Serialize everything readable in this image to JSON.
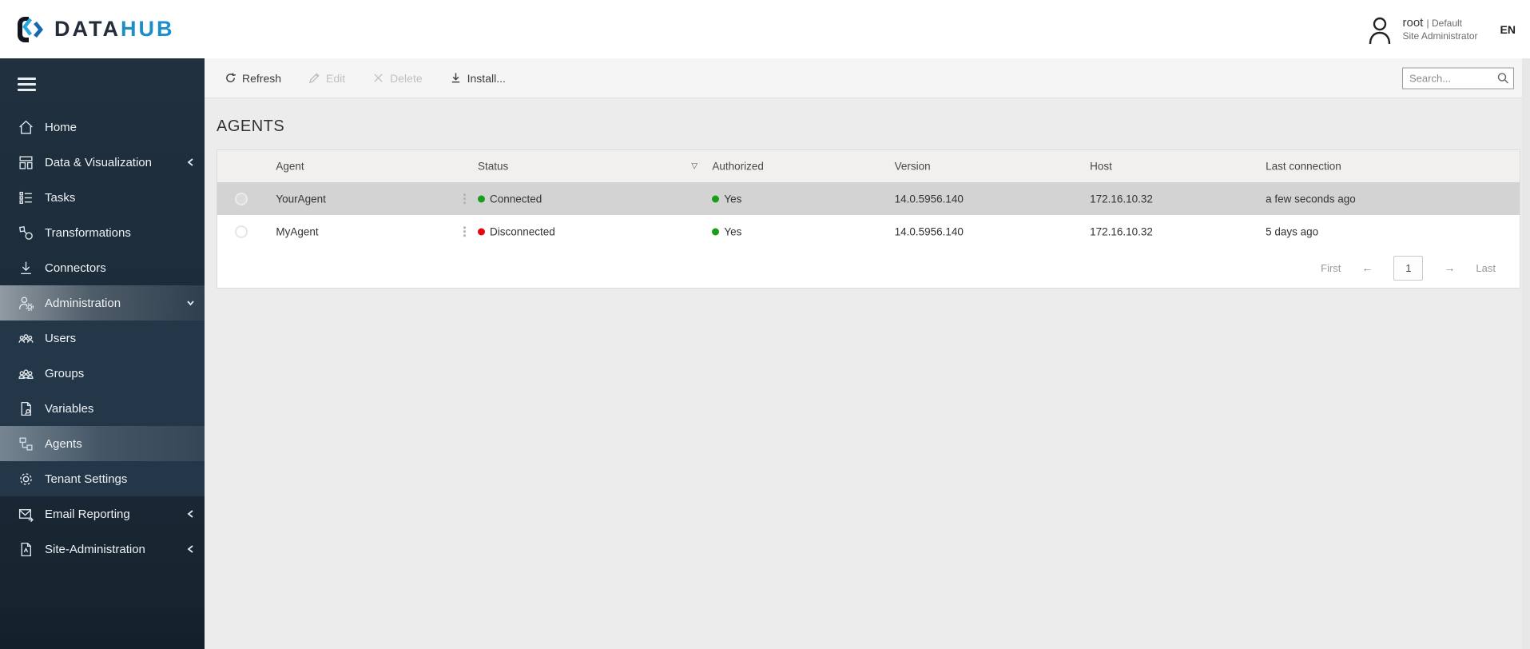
{
  "brand": {
    "word1": "DATA",
    "word2": "HUB"
  },
  "header": {
    "user_name": "root",
    "user_suffix": "| Default",
    "user_role": "Site Administrator",
    "language": "EN"
  },
  "sidebar": {
    "items": [
      {
        "label": "Home"
      },
      {
        "label": "Data & Visualization",
        "chevron": "left"
      },
      {
        "label": "Tasks"
      },
      {
        "label": "Transformations"
      },
      {
        "label": "Connectors"
      },
      {
        "label": "Administration",
        "chevron": "down",
        "selected": true,
        "expanded": true
      },
      {
        "label": "Users",
        "sub": true
      },
      {
        "label": "Groups",
        "sub": true
      },
      {
        "label": "Variables",
        "sub": true
      },
      {
        "label": "Agents",
        "sub": true,
        "selected": true
      },
      {
        "label": "Tenant Settings",
        "sub": true
      },
      {
        "label": "Email Reporting",
        "chevron": "left"
      },
      {
        "label": "Site-Administration",
        "chevron": "left"
      }
    ]
  },
  "toolbar": {
    "refresh_label": "Refresh",
    "edit_label": "Edit",
    "delete_label": "Delete",
    "install_label": "Install...",
    "search_placeholder": "Search..."
  },
  "page": {
    "title": "AGENTS"
  },
  "table": {
    "columns": {
      "agent": "Agent",
      "status": "Status",
      "authorized": "Authorized",
      "version": "Version",
      "host": "Host",
      "last_connection": "Last connection"
    },
    "sort_glyph": "▽",
    "rows": [
      {
        "agent": "YourAgent",
        "status": "Connected",
        "status_color": "#1a9e1a",
        "authorized": "Yes",
        "authorized_color": "#1a9e1a",
        "version": "14.0.5956.140",
        "host": "172.16.10.32",
        "last_connection": "a few seconds ago",
        "selected": true
      },
      {
        "agent": "MyAgent",
        "status": "Disconnected",
        "status_color": "#e30613",
        "authorized": "Yes",
        "authorized_color": "#1a9e1a",
        "version": "14.0.5956.140",
        "host": "172.16.10.32",
        "last_connection": "5 days ago",
        "selected": false
      }
    ]
  },
  "pagination": {
    "first": "First",
    "prev": "←",
    "current": "1",
    "next": "→",
    "last": "Last"
  }
}
